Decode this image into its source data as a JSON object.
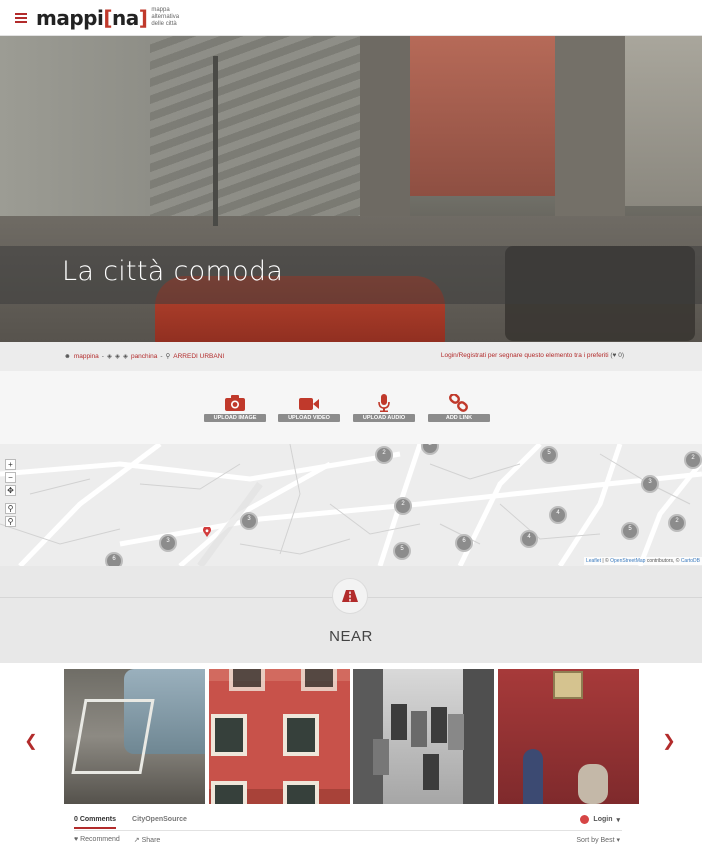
{
  "header": {
    "logo_main": "mappi",
    "logo_bracket_open": "[",
    "logo_na": "na",
    "logo_bracket_close": "]",
    "tagline_1": "mappa",
    "tagline_2": "alternativa",
    "tagline_3": "delle città"
  },
  "hero": {
    "title": "La città comoda"
  },
  "info": {
    "author": "mappina",
    "sep1": "-",
    "tag": "panchina",
    "sep2": "-",
    "category": "ARREDI URBANI",
    "favorite_text": "Login/Registrati per segnare questo elemento tra i preferiti",
    "favorite_count": "0"
  },
  "uploads": [
    {
      "label": "UPLOAD IMAGE",
      "icon": "camera-icon"
    },
    {
      "label": "UPLOAD VIDEO",
      "icon": "video-camera-icon"
    },
    {
      "label": "UPLOAD AUDIO",
      "icon": "microphone-icon"
    },
    {
      "label": "ADD LINK",
      "icon": "link-icon"
    }
  ],
  "map": {
    "zoom_in": "+",
    "zoom_out": "−",
    "attribution_leaflet": "Leaflet",
    "attribution_mid": " | © ",
    "attribution_osm": "OpenStreetMap",
    "attribution_end": " contributors, © ",
    "attribution_carto": "CartoDB",
    "clusters": [
      {
        "count": "2"
      },
      {
        "count": "2"
      },
      {
        "count": "5"
      },
      {
        "count": "2"
      },
      {
        "count": "3"
      },
      {
        "count": "3"
      },
      {
        "count": "2"
      },
      {
        "count": "4"
      },
      {
        "count": "3"
      },
      {
        "count": "2"
      },
      {
        "count": "5"
      },
      {
        "count": "6"
      },
      {
        "count": "4"
      },
      {
        "count": "5"
      },
      {
        "count": "6"
      }
    ]
  },
  "near": {
    "label": "NEAR"
  },
  "carousel": {
    "prev": "❮",
    "next": "❯"
  },
  "comments": {
    "tab_comments": "0 Comments",
    "tab_source": "CityOpenSource",
    "login": "Login",
    "recommend": "Recommend",
    "share": "Share",
    "sort": "Sort by Best"
  },
  "colors": {
    "accent": "#b22b2b",
    "band": "#ececec"
  }
}
